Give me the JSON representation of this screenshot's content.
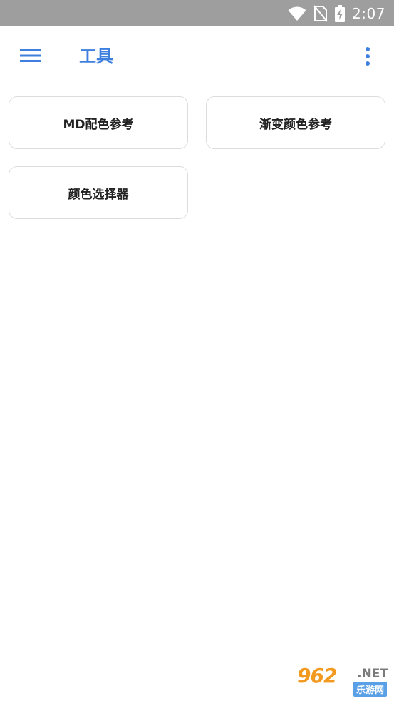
{
  "status_bar": {
    "time": "2:07",
    "icons": [
      "wifi-icon",
      "no-sim-icon",
      "battery-charging-icon"
    ]
  },
  "app_bar": {
    "title": "工具",
    "menu_icon": "menu-icon",
    "overflow_icon": "more-vert-icon"
  },
  "tools": [
    {
      "label": "MD配色参考"
    },
    {
      "label": "渐变颜色参考"
    },
    {
      "label": "颜色选择器"
    }
  ],
  "watermark": {
    "brand": "962",
    "suffix": ".NET",
    "sub": "乐游网"
  },
  "colors": {
    "status_bar_bg": "#9e9e9e",
    "accent": "#3f80de",
    "card_border": "#dcdcdc",
    "card_text": "#222222"
  }
}
